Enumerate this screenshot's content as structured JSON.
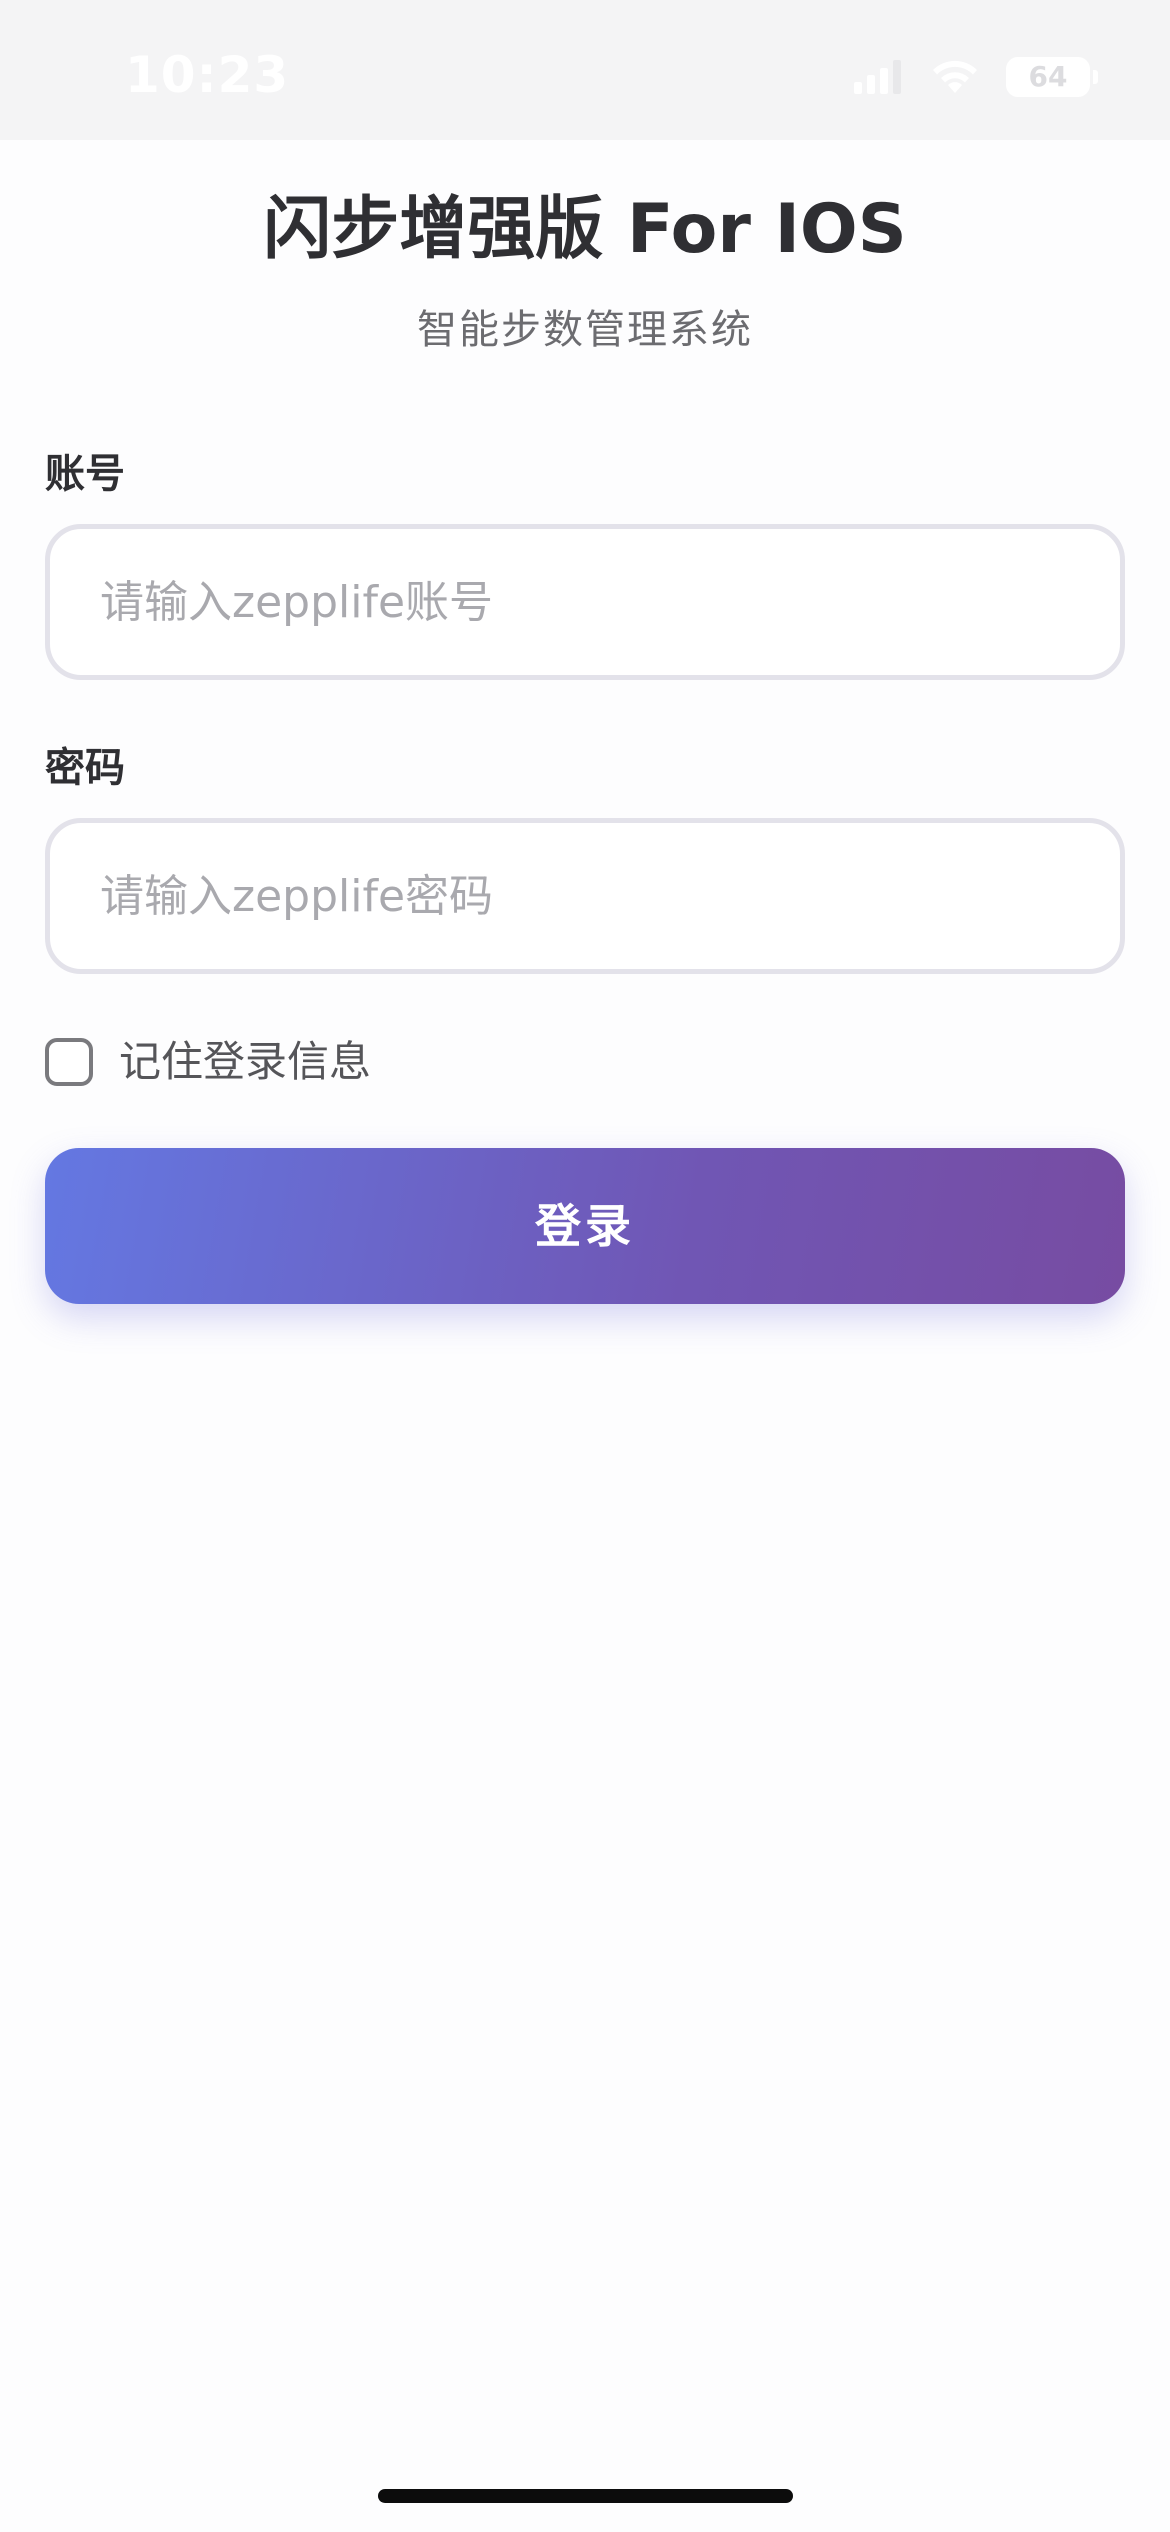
{
  "status_bar": {
    "time": "10:23",
    "battery_level": "64",
    "icons": [
      "signal-icon",
      "wifi-icon",
      "battery-icon"
    ]
  },
  "header": {
    "title": "闪步增强版 For IOS",
    "subtitle": "智能步数管理系统"
  },
  "form": {
    "account": {
      "label": "账号",
      "placeholder": "请输入zepplife账号",
      "value": ""
    },
    "password": {
      "label": "密码",
      "placeholder": "请输入zepplife密码",
      "value": ""
    },
    "remember": {
      "label": "记住登录信息",
      "checked": false
    },
    "submit_label": "登录"
  },
  "colors": {
    "button_gradient_start": "#6478e2",
    "button_gradient_end": "#774ca2",
    "input_border": "#e3e2ea",
    "status_bar_bg": "#f4f4f5"
  }
}
